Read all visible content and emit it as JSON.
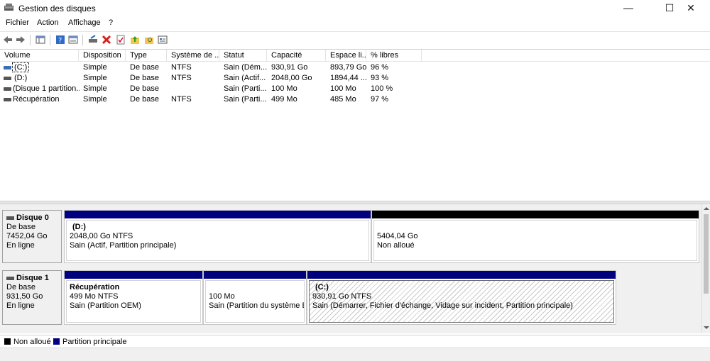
{
  "window": {
    "title": "Gestion des disques",
    "minimize": "—",
    "maximize": "☐",
    "close": "✕"
  },
  "menu": {
    "items": [
      "Fichier",
      "Action",
      "Affichage",
      "?"
    ]
  },
  "toolbar": {
    "icons": [
      "back-icon",
      "forward-icon",
      "properties-grid-icon",
      "help-icon",
      "console-view-icon",
      "rescan-icon",
      "delete-icon",
      "check-icon",
      "folder-up-icon",
      "folder-search-icon",
      "list-view-icon"
    ]
  },
  "volumes": {
    "columns": [
      "Volume",
      "Disposition",
      "Type",
      "Système de ...",
      "Statut",
      "Capacité",
      "Espace li...",
      "% libres"
    ],
    "rows": [
      {
        "volume": "(C:)",
        "disposition": "Simple",
        "type": "De base",
        "fs": "NTFS",
        "status": "Sain (Dém...",
        "capacity": "930,91 Go",
        "free": "893,79 Go",
        "pct": "96 %"
      },
      {
        "volume": "(D:)",
        "disposition": "Simple",
        "type": "De base",
        "fs": "NTFS",
        "status": "Sain (Actif...",
        "capacity": "2048,00 Go",
        "free": "1894,44 ...",
        "pct": "93 %"
      },
      {
        "volume": "(Disque 1 partition...",
        "disposition": "Simple",
        "type": "De base",
        "fs": "",
        "status": "Sain (Parti...",
        "capacity": "100 Mo",
        "free": "100 Mo",
        "pct": "100 %"
      },
      {
        "volume": "Récupération",
        "disposition": "Simple",
        "type": "De base",
        "fs": "NTFS",
        "status": "Sain (Parti...",
        "capacity": "499 Mo",
        "free": "485 Mo",
        "pct": "97 %"
      }
    ]
  },
  "disks": [
    {
      "name": "Disque 0",
      "type": "De base",
      "size": "7452,04 Go",
      "status": "En ligne",
      "partitions": [
        {
          "title": "(D:)",
          "size": "2048,00 Go NTFS",
          "status": "Sain (Actif, Partition principale)"
        },
        {
          "title": "",
          "size": "5404,04 Go",
          "status": "Non alloué"
        }
      ]
    },
    {
      "name": "Disque 1",
      "type": "De base",
      "size": "931,50 Go",
      "status": "En ligne",
      "partitions": [
        {
          "title": "Récupération",
          "size": "499 Mo NTFS",
          "status": "Sain (Partition OEM)"
        },
        {
          "title": "",
          "size": "100 Mo",
          "status": "Sain (Partition du système EF"
        },
        {
          "title": "(C:)",
          "size": "930,91 Go NTFS",
          "status": "Sain (Démarrer, Fichier d'échange, Vidage sur incident, Partition principale)"
        }
      ]
    }
  ],
  "legend": {
    "unallocated": "Non alloué",
    "primary": "Partition principale"
  },
  "colors": {
    "primary_partition": "#00007f",
    "unallocated": "#000000"
  }
}
